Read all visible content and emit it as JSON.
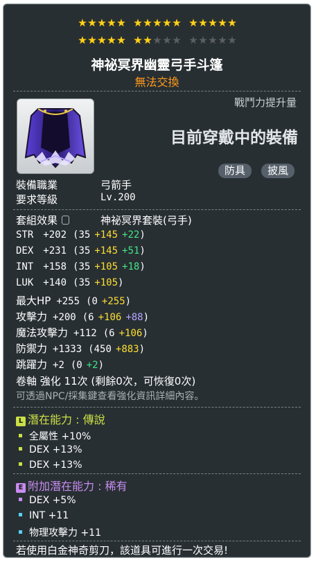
{
  "stars": {
    "rows": [
      {
        "groups": [
          [
            "on",
            "on",
            "on",
            "on",
            "on"
          ],
          [
            "on",
            "on",
            "on",
            "on",
            "on"
          ],
          [
            "on",
            "on",
            "on",
            "on",
            "on"
          ]
        ]
      },
      {
        "groups": [
          [
            "on",
            "on",
            "on",
            "on",
            "on"
          ],
          [
            "on",
            "on",
            "off",
            "off",
            "off"
          ],
          [
            "off",
            "off",
            "off",
            "off",
            "off"
          ]
        ]
      }
    ],
    "filled_count": 22,
    "total": 30
  },
  "item": {
    "name": "神祕冥界幽靈弓手斗篷",
    "trade_status": "無法交換"
  },
  "power": {
    "label": "戰鬥力提升量",
    "equipped_text": "目前穿戴中的裝備"
  },
  "tags": [
    "防具",
    "披風"
  ],
  "requirements": {
    "job_label": "裝備職業",
    "job_value": "弓箭手",
    "level_label": "要求等級",
    "level_value": "Lv.200"
  },
  "set": {
    "label": "套組效果",
    "value": "神祕冥界套裝(弓手)"
  },
  "stats": [
    {
      "name": "STR",
      "total": "+202",
      "base": "(35",
      "scroll": "+145",
      "extra": "+22",
      "extra_color": "green",
      "close": ")"
    },
    {
      "name": "DEX",
      "total": "+231",
      "base": "(35",
      "scroll": "+145",
      "extra": "+51",
      "extra_color": "green",
      "close": ")"
    },
    {
      "name": "INT",
      "total": "+158",
      "base": "(35",
      "scroll": "+105",
      "extra": "+18",
      "extra_color": "green",
      "close": ")"
    },
    {
      "name": "LUK",
      "total": "+140",
      "base": "(35",
      "scroll": "+105",
      "extra": "",
      "extra_color": "green",
      "close": ")"
    },
    {
      "name": "最大HP",
      "total": "+255",
      "base": "(0",
      "scroll": "+255",
      "extra": "",
      "extra_color": "green",
      "close": ")"
    },
    {
      "name": "攻擊力",
      "total": "+200",
      "base": "(6",
      "scroll": "+106",
      "extra": "+88",
      "extra_color": "purple",
      "close": ")"
    },
    {
      "name": "魔法攻擊力",
      "total": "+112",
      "base": "(6",
      "scroll": "+106",
      "extra": "",
      "extra_color": "green",
      "close": ")"
    },
    {
      "name": "防禦力",
      "total": "+1333",
      "base": "(450",
      "scroll": "+883",
      "extra": "",
      "extra_color": "green",
      "close": ")"
    },
    {
      "name": "跳躍力",
      "total": "+2",
      "base": "(0",
      "scroll": "",
      "extra": "+2",
      "extra_color": "green",
      "close": ")"
    }
  ],
  "scroll": {
    "line": "卷軸 強化 11次 (剩餘0次，可恢復0次)",
    "hint": "可透過NPC/採集鍵查看強化資訊詳細內容。"
  },
  "potential": {
    "badge": "L",
    "label": "潛在能力 : 傳說",
    "color": "#cbe046",
    "lines": [
      "全屬性 +10%",
      "DEX +13%",
      "DEX +13%"
    ]
  },
  "additional": {
    "badge": "E",
    "label": "附加潛在能力 : 稀有",
    "color": "#c78cf0",
    "lines": [
      {
        "text": "DEX +5%",
        "dot": "#c78cf0"
      },
      {
        "text": "INT +11",
        "dot": "#5ad1f0"
      },
      {
        "text": "物理攻擊力 +11",
        "dot": "#5ad1f0"
      }
    ]
  },
  "footer": "若使用白金神奇剪刀，該道具可進行一次交易!"
}
